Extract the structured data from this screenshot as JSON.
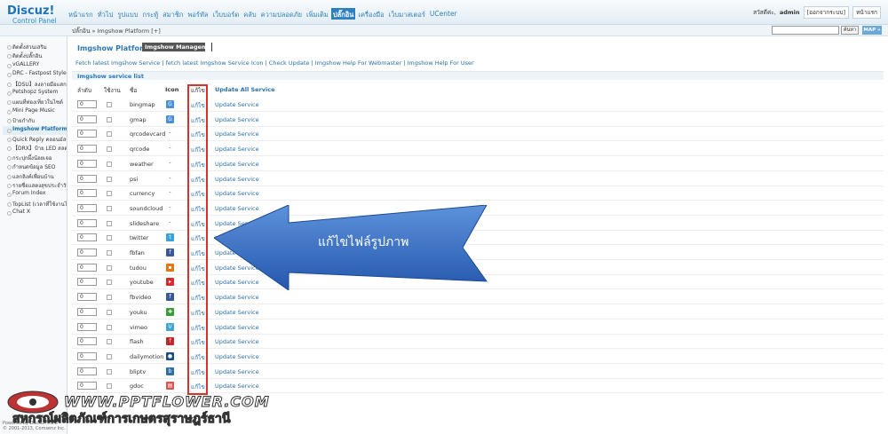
{
  "logo": {
    "brand": "Discuz!",
    "sub": "Control Panel"
  },
  "topnav": [
    "หน้าแรก",
    "ทั่วไป",
    "รูปแบบ",
    "กระทู้",
    "สมาชิก",
    "พอร์ทัล",
    "เว็บบอร์ด",
    "คลับ",
    "ความปลอดภัย",
    "เพิ่มเติม",
    "ปลั๊กอิน",
    "เครื่องมือ",
    "เว็บมาสเตอร์",
    "UCenter"
  ],
  "topnav_active": "ปลั๊กอิน",
  "user": {
    "greeting": "สวัสดีค่ะ,",
    "name": "admin",
    "logout": "[ออกจากระบบ]",
    "home": "หน้าแรก"
  },
  "breadcrumb": "ปลั๊กอิน » Imgshow Platform  [+]",
  "search": {
    "button": "ค้นหา",
    "map": "MAP »"
  },
  "sidebar": [
    "ติดตั้งส่วนเสริม",
    "ติดตั้งปลั๊กอิน",
    "vGALLERY",
    "DRC - Fastpost Style",
    "【DSU】ลงลายมือแสกน้ำ",
    "Petshopz System",
    "แผนที่ท่องเที่ยวในไซต์",
    "Mini Page Music",
    "ป้ายกำกับ",
    "Imgshow Platform",
    "Quick Reply คลอนมัลเตอร์",
    "【DRX】ป้าย LED สลด",
    "กระปุกผึ้งน้อยเจอ",
    "กำหนดข้อมูล SEO",
    "แลกลิงค์เพื่อนบ้าน",
    "รายชื่อแสดงสุขประจำวัน",
    "Forum Index",
    "TopList (เวลาที่ใช้งานได้เพิ่มเติม)",
    "Chat X"
  ],
  "sidebar_active": "Imgshow Platform",
  "footer": [
    "Powered by Discuz! X3.0",
    "© 2001-2013, Comsenz Inc."
  ],
  "page": {
    "title": "Imgshow Platform",
    "tab": "Imgshow Management"
  },
  "links": "Fetch latest Imgshow Service | fetch latest Imgshow Service Icon | Check Update | Imgshow Help For Webmaster | Imgshow Help For User",
  "list_title": "Imgshow service list",
  "headers": {
    "order": "ลำดับ",
    "enabled": "ใช้งาน",
    "name": "ชื่อ",
    "icon": "Icon",
    "edit": "แก้ไข",
    "update_all": "Update All Service"
  },
  "rows": [
    {
      "order": "0",
      "name": "bingmap",
      "icon": "G",
      "color": "#4a90d9",
      "edit": "แก้ไข",
      "update": "Update Service"
    },
    {
      "order": "0",
      "name": "gmap",
      "icon": "G",
      "color": "#4a90d9",
      "edit": "แก้ไข",
      "update": "Update Service"
    },
    {
      "order": "0",
      "name": "qrcodevcard",
      "icon": "-",
      "color": "",
      "edit": "แก้ไข",
      "update": "Update Service"
    },
    {
      "order": "0",
      "name": "qrcode",
      "icon": "-",
      "color": "",
      "edit": "แก้ไข",
      "update": "Update Service"
    },
    {
      "order": "0",
      "name": "weather",
      "icon": "-",
      "color": "",
      "edit": "แก้ไข",
      "update": "Update Service"
    },
    {
      "order": "0",
      "name": "psi",
      "icon": "-",
      "color": "",
      "edit": "แก้ไข",
      "update": "Update Service"
    },
    {
      "order": "0",
      "name": "currency",
      "icon": "-",
      "color": "",
      "edit": "แก้ไข",
      "update": "Update Service"
    },
    {
      "order": "0",
      "name": "soundcloud",
      "icon": "-",
      "color": "",
      "edit": "แก้ไข",
      "update": "Update Service"
    },
    {
      "order": "0",
      "name": "slideshare",
      "icon": "-",
      "color": "",
      "edit": "แก้ไข",
      "update": "Update Service"
    },
    {
      "order": "0",
      "name": "twitter",
      "icon": "t",
      "color": "#3aa3dc",
      "edit": "แก้ไข",
      "update": "Update Service"
    },
    {
      "order": "0",
      "name": "fbfan",
      "icon": "f",
      "color": "#3b5998",
      "edit": "แก้ไข",
      "update": "Update Service"
    },
    {
      "order": "0",
      "name": "tudou",
      "icon": "▪",
      "color": "#e8750d",
      "edit": "แก้ไข",
      "update": "Update Service"
    },
    {
      "order": "0",
      "name": "youtube",
      "icon": "▸",
      "color": "#d92b2b",
      "edit": "แก้ไข",
      "update": "Update Service"
    },
    {
      "order": "0",
      "name": "fbvideo",
      "icon": "f",
      "color": "#3b5998",
      "edit": "แก้ไข",
      "update": "Update Service"
    },
    {
      "order": "0",
      "name": "youku",
      "icon": "✚",
      "color": "#3a9d3a",
      "edit": "แก้ไข",
      "update": "Update Service"
    },
    {
      "order": "0",
      "name": "vimeo",
      "icon": "V",
      "color": "#44a3d6",
      "edit": "แก้ไข",
      "update": "Update Service"
    },
    {
      "order": "0",
      "name": "flash",
      "icon": "f",
      "color": "#c0262a",
      "edit": "แก้ไข",
      "update": "Update Service"
    },
    {
      "order": "0",
      "name": "dailymotion",
      "icon": "●",
      "color": "#1b4d8a",
      "edit": "แก้ไข",
      "update": "Update Service"
    },
    {
      "order": "0",
      "name": "bliptv",
      "icon": "b",
      "color": "#2d6fa6",
      "edit": "แก้ไข",
      "update": "Update Service"
    },
    {
      "order": "0",
      "name": "gdoc",
      "icon": "▤",
      "color": "#d9534f",
      "edit": "แก้ไข",
      "update": "Update Service"
    }
  ],
  "callout": "แก้ไขไฟล์รูปภาพ",
  "watermark": {
    "url": "WWW.PPTFLOWER.COM",
    "line2": "สหกรณ์ผลิตภัณฑ์การเกษตรสุราษฎร์ธานี"
  },
  "colors": {
    "accent": "#2d7fc2",
    "link": "#2a6fa8",
    "highlight": "#d9322b",
    "arrow": "#2e6cc4"
  }
}
